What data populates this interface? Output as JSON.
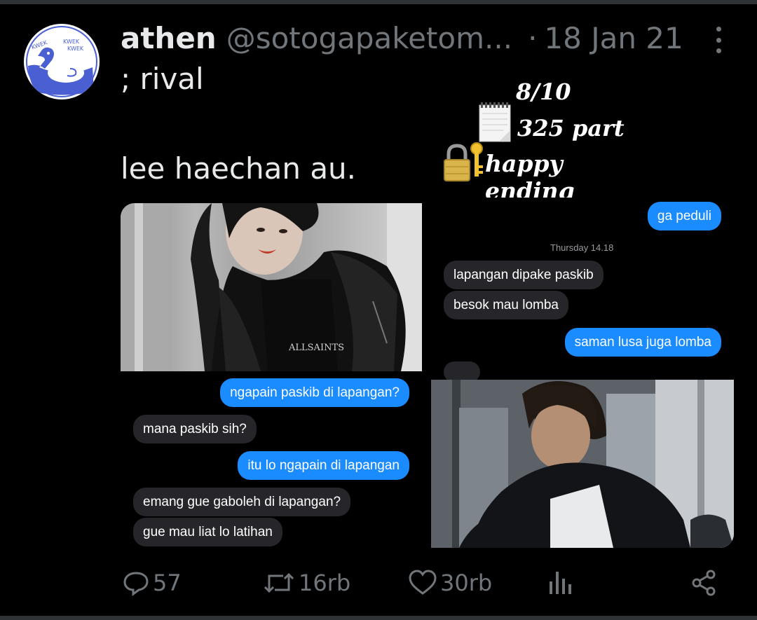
{
  "tweet": {
    "display_name": "athen",
    "handle": "@sotogapaketom...",
    "separator": "·",
    "date": "18 Jan 21",
    "line1": "; rival",
    "line2": "lee haechan au."
  },
  "avatar": {
    "texts": [
      "KWEK",
      "KWEK",
      "KWEK"
    ],
    "colors": {
      "bg": "#ffffff",
      "ink": "#4a5fd1"
    }
  },
  "rating": {
    "score": "8/10",
    "parts": "325 part",
    "ending": "happy ending",
    "icons": [
      "notepad-icon",
      "lock-key-icon"
    ]
  },
  "chat_top": {
    "messages": [
      {
        "type": "sent",
        "text": "ga peduli"
      },
      {
        "type": "time",
        "text": "Thursday 14.18"
      },
      {
        "type": "recv",
        "text": "lapangan dipake paskib"
      },
      {
        "type": "recv",
        "text": "besok mau lomba"
      },
      {
        "type": "sent",
        "text": "saman lusa juga lomba"
      }
    ]
  },
  "chat_bottom": {
    "messages": [
      {
        "type": "sent",
        "text": "ngapain paskib di lapangan?"
      },
      {
        "type": "recv",
        "text": "mana paskib sih?"
      },
      {
        "type": "sent",
        "text": "itu lo ngapain di lapangan"
      },
      {
        "type": "recv",
        "text": "emang gue gaboleh di lapangan?"
      },
      {
        "type": "recv",
        "text": "gue mau liat lo latihan"
      }
    ]
  },
  "photos": {
    "shirt_text": "ALLSAINTS"
  },
  "actions": {
    "replies": "57",
    "retweets": "16rb",
    "likes": "30rb",
    "icons": [
      "reply-icon",
      "retweet-icon",
      "like-icon",
      "analytics-icon",
      "share-icon"
    ]
  },
  "colors": {
    "background": "#000000",
    "text": "#e7e9ea",
    "muted": "#71767b",
    "imessage_blue": "#1a8cff",
    "imessage_gray": "#26252a"
  }
}
